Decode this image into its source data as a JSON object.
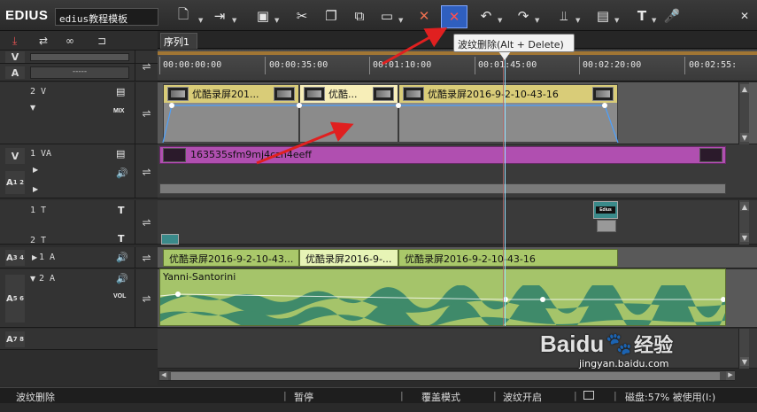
{
  "app": {
    "title": "EDIUS",
    "project_name": "edius教程模板"
  },
  "toolbar": {
    "buttons": [
      "new-project-icon",
      "import-icon",
      "save-icon",
      "cut-icon",
      "copy-icon",
      "paste-icon",
      "paste-insert-icon",
      "delete-icon",
      "ripple-delete-icon",
      "undo-icon",
      "redo-icon",
      "split-icon",
      "render-icon",
      "title-icon",
      "voiceover-icon",
      "collapse-icon"
    ],
    "tooltip": "波纹删除(Alt + Delete)"
  },
  "sequence": {
    "tab": "序列1"
  },
  "ruler": {
    "timecodes": [
      "00:00:00:00",
      "00:00:35:00",
      "00:01:10:00",
      "00:01:45:00",
      "00:02:20:00",
      "00:02:55:"
    ]
  },
  "tracks": {
    "v2": {
      "name": "2 V",
      "mix": "MIX"
    },
    "va1": {
      "name": "1 VA",
      "row_label": "A",
      "row_num": "1 2"
    },
    "t1": {
      "name": "1 T",
      "name2": "2 T"
    },
    "a1": {
      "name": "1 A",
      "row_label": "A",
      "row_num": "3 4"
    },
    "a2": {
      "name": "2 A",
      "vol": "VOL",
      "row_label": "A",
      "row_num": "5 6"
    },
    "a78": {
      "row_label": "A",
      "row_num": "7 8"
    },
    "lock_labels": [
      "V",
      "A"
    ],
    "timecode_placeholder": "-----"
  },
  "clips": {
    "v2": [
      "优酷录屏201...",
      "优酷...",
      "优酷录屏2016-9-2-10-43-16"
    ],
    "va1": "163535sfm9mj4czn4eeff",
    "title_clip": "Edius",
    "a1": [
      "优酷录屏2016-9-2-10-43...",
      "优酷录屏2016-9-...",
      "优酷录屏2016-9-2-10-43-16"
    ],
    "a2": "Yanni-Santorini"
  },
  "status": {
    "mode": "波纹删除",
    "pause": "暂停",
    "overwrite": "覆盖模式",
    "ripple": "波纹开启",
    "disk": "磁盘:57% 被使用(I:)"
  },
  "watermark": {
    "brand": "Baidu",
    "text": "经验",
    "url": "jingyan.baidu.com"
  },
  "colors": {
    "clip_video_header": "#d9cc78",
    "clip_selected": "#f7eeb8",
    "clip_va": "#b04fb0",
    "clip_audio": "#a9c86a",
    "annotation_arrow": "#e02020",
    "playhead": "#9be0ff"
  }
}
